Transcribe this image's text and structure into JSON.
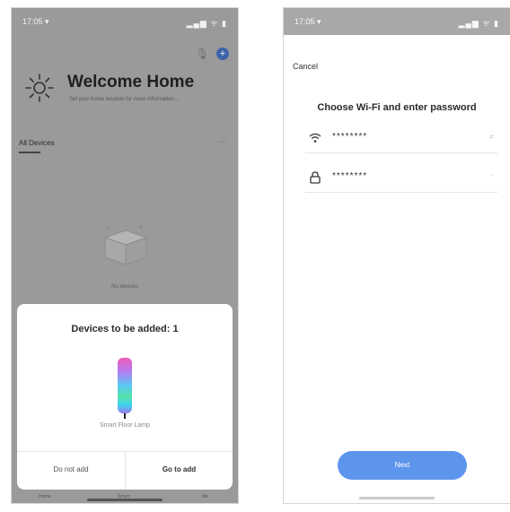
{
  "left_screen": {
    "status": {
      "time": "17:05 ▾",
      "indicators": "▂▄▆ ᯤ ▮"
    },
    "header": {
      "mic_icon": "microphone-icon",
      "add_icon": "plus-circle-icon",
      "weather_icon": "sun-icon"
    },
    "welcome_title": "Welcome Home",
    "welcome_subtitle": "Set your home location for more information...",
    "devices_tab": "All Devices",
    "more": "···",
    "empty_state": "No devices",
    "sheet": {
      "title": "Devices to be added: 1",
      "device_name": "Smart Floor Lamp",
      "lamp_colors": [
        "#f05ab8",
        "#b47cf0",
        "#59c8f5",
        "#56e3a8",
        "#3fd2f0",
        "#9a7af0"
      ],
      "cancel_label": "Do not add",
      "confirm_label": "Go to add"
    },
    "tabbar": [
      "Home",
      "Smart",
      "Me"
    ]
  },
  "right_screen": {
    "status": {
      "time": "17:05 ▾",
      "indicators": "▂▄▆ ᯤ ▮"
    },
    "cancel_label": "Cancel",
    "heading": "Choose Wi-Fi and enter password",
    "wifi": {
      "icon": "wifi-icon",
      "value": "********",
      "chevron": "⇄"
    },
    "password": {
      "icon": "lock-icon",
      "value": "********",
      "chevron": "◦◦"
    },
    "next_label": "Next"
  },
  "colors": {
    "accent": "#5d95ec",
    "plus_button": "#3e63a8",
    "overlay": "#9a9a9a"
  }
}
